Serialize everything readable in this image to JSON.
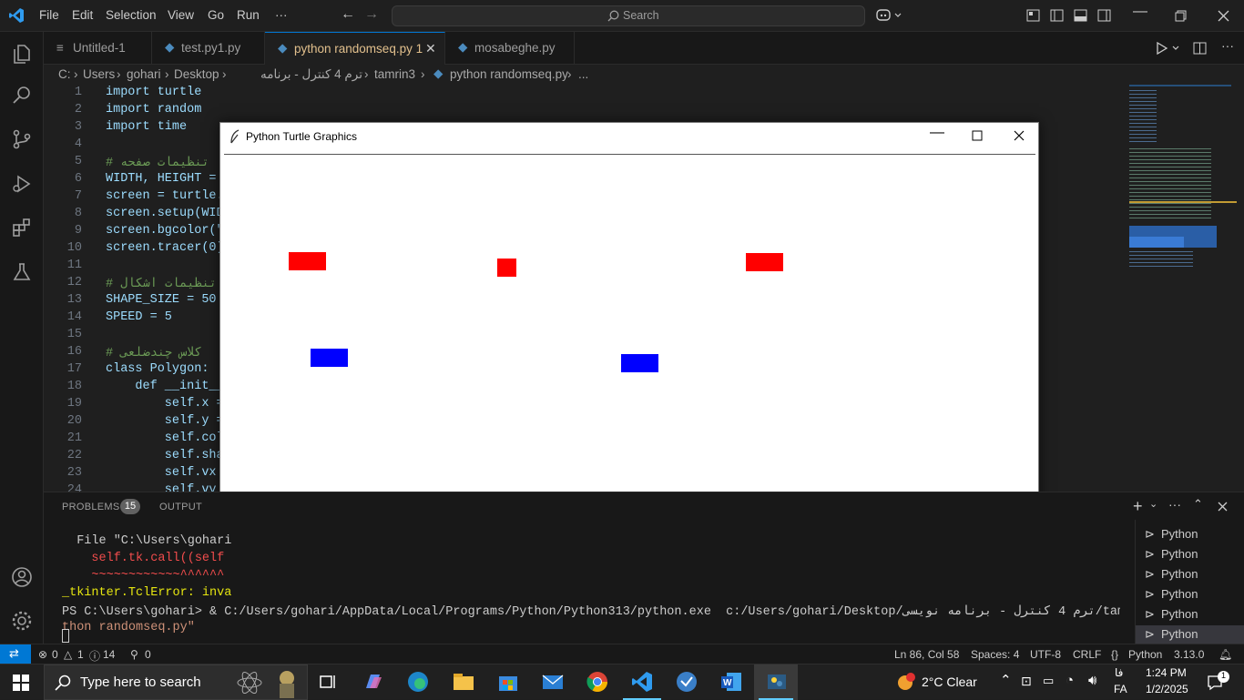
{
  "menubar": {
    "items": [
      "File",
      "Edit",
      "Selection",
      "View",
      "Go",
      "Run",
      "···"
    ],
    "search_placeholder": "Search"
  },
  "tabs": [
    {
      "label": "Untitled-1",
      "active": false
    },
    {
      "label": "test.py1.py",
      "active": false
    },
    {
      "label": "python randomseq.py 1",
      "active": true
    },
    {
      "label": "mosabeghe.py",
      "active": false
    }
  ],
  "breadcrumb": [
    "C:",
    "Users",
    "gohari",
    "Desktop",
    "ترم 4 کنترل - برنامه نویسی",
    "tamrin3",
    "python randomseq.py",
    "..."
  ],
  "editor": {
    "line_numbers": [
      "1",
      "2",
      "3",
      "4",
      "5",
      "6",
      "7",
      "8",
      "9",
      "10",
      "11",
      "12",
      "13",
      "14",
      "15",
      "16",
      "17",
      "18",
      "19",
      "20",
      "21",
      "22",
      "23",
      "24"
    ],
    "lines": [
      "import turtle",
      "import random",
      "import time",
      "",
      "# تنظیمات صفحه",
      "WIDTH, HEIGHT =",
      "screen = turtle.",
      "screen.setup(WID",
      "screen.bgcolor(\"",
      "screen.tracer(0)",
      "",
      "# تنظیمات اشکال",
      "SHAPE_SIZE = 50",
      "SPEED = 5",
      "",
      "# کلاس چندضلعی",
      "class Polygon:",
      "    def __init__",
      "        self.x =",
      "        self.y =",
      "        self.col",
      "        self.sha",
      "        self.vx",
      "        self.vy"
    ]
  },
  "panel": {
    "tabs": {
      "problems": "PROBLEMS",
      "problems_count": "15",
      "output": "OUTPUT"
    },
    "terminal": [
      "  File \"C:\\Users\\gohari",
      "    self.tk.call((self",
      "    ~~~~~~~~~~~~^^^^^^",
      "_tkinter.TclError: inva",
      "PS C:\\Users\\gohari> & C:/Users/gohari/AppData/Local/Programs/Python/Python313/python.exe  c:/Users/gohari/Desktop/ترم 4 کنترل - برنامه نویسی/tamrin3/py",
      "thon randomseq.py\""
    ],
    "terminal_list": [
      "Python",
      "Python",
      "Python",
      "Python",
      "Python",
      "Python"
    ]
  },
  "statusbar": {
    "errors": "0",
    "warnings": "1",
    "info": "14",
    "ports": "0",
    "position": "Ln 86, Col 58",
    "spaces": "Spaces: 4",
    "encoding": "UTF-8",
    "eol": "CRLF",
    "language": "Python",
    "version": "3.13.0"
  },
  "turtle_window": {
    "title": "Python Turtle Graphics",
    "shapes": [
      {
        "type": "rect",
        "color": "#ff0000"
      },
      {
        "type": "rect",
        "color": "#ff0000"
      },
      {
        "type": "rect",
        "color": "#ff0000"
      },
      {
        "type": "rect",
        "color": "#0000ff"
      },
      {
        "type": "rect",
        "color": "#0000ff"
      },
      {
        "type": "rect",
        "color": "#ff0000"
      },
      {
        "type": "triangle",
        "color": "#0000ff"
      }
    ]
  },
  "taskbar": {
    "search_placeholder": "Type here to search",
    "weather": "2°C  Clear",
    "lang_top": "فا",
    "lang_bottom": "FA",
    "time": "1:24 PM",
    "date": "1/2/2025",
    "notification_count": "1"
  },
  "colors": {
    "accent": "#0078d4",
    "editor_bg": "#1f1f1f",
    "active_tab_text": "#e2c08d"
  }
}
